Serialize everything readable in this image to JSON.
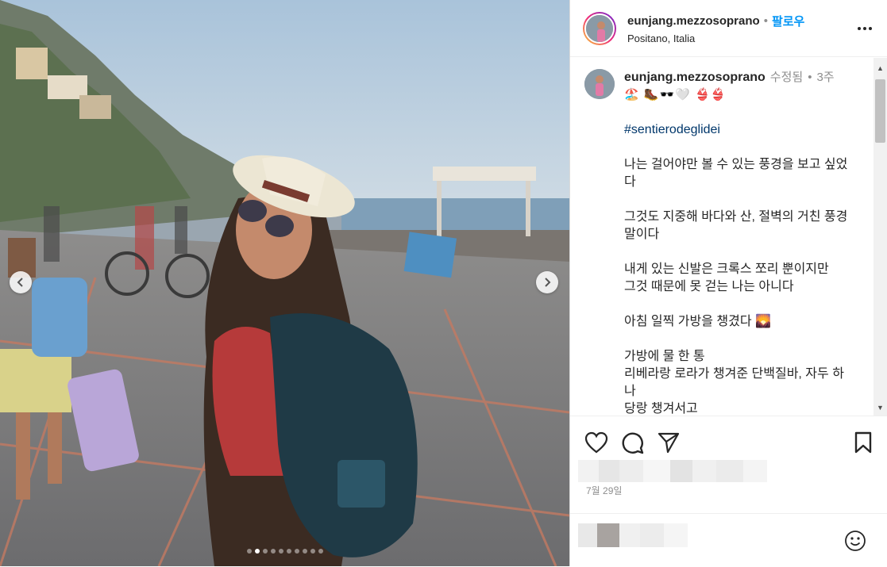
{
  "header": {
    "username": "eunjang.mezzosoprano",
    "separator": "•",
    "follow_label": "팔로우",
    "location": "Positano, Italia"
  },
  "caption": {
    "username": "eunjang.mezzosoprano",
    "edited": "수정됨",
    "separator": "•",
    "age": "3주",
    "emoji_line": "🏖️ 🥾🕶️🤍 👙👙",
    "hashtag": "#sentierodeglidei",
    "lines": [
      "나는 걸어야만 볼 수 있는 풍경을 보고 싶었다",
      "그것도 지중해 바다와 산, 절벽의 거친 풍경 말이다",
      "내게 있는 신발은 크록스 쪼리 뿐이지만",
      "그것 때문에 못 걷는 나는 아니다",
      "아침 일찍 가방을 챙겼다 🌄",
      "가방에 물 한 통",
      "리베라랑 로라가 챙겨준 단백질바, 자두 하나",
      "당랑 챙겨서고"
    ]
  },
  "post": {
    "date": "7월 29일"
  },
  "carousel": {
    "total_slides": 10,
    "active_index": 1
  },
  "colors": {
    "follow": "#0095f6",
    "hashtag": "#00376b",
    "muted": "#8e8e8e",
    "text": "#262626"
  },
  "icons": [
    "chevron-left-icon",
    "chevron-right-icon",
    "more-icon",
    "heart-icon",
    "comment-icon",
    "share-icon",
    "bookmark-icon",
    "emoji-icon"
  ]
}
